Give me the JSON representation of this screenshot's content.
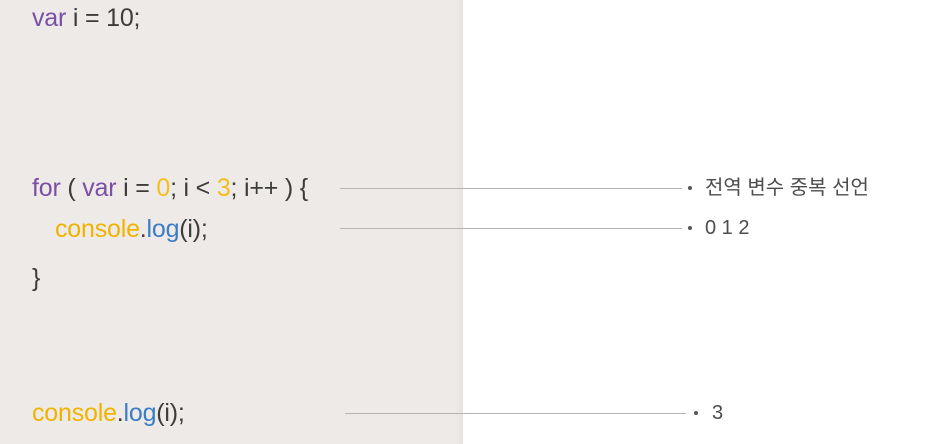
{
  "code": {
    "lines": [
      [
        "var",
        " i = 10;"
      ],
      [
        "for",
        " ( ",
        "var",
        " i = ",
        "0",
        "; i < ",
        "3",
        "; i++ ) {"
      ],
      [
        "console",
        ".",
        "log",
        "(i);"
      ],
      [
        "}"
      ],
      [
        "console",
        ".",
        "log",
        "(i);"
      ]
    ]
  },
  "annotations": [
    {
      "text": "전역 변수 중복 선언"
    },
    {
      "text": "0 1 2"
    },
    {
      "text": "3"
    }
  ],
  "colors": {
    "page_bg": "#ffffff",
    "panel": "#eeeae7",
    "keyword": "#7a4fa6",
    "plain": "#3c3c3c",
    "number": "#f4be1e",
    "object": "#f0b300",
    "method": "#3b7dc6",
    "connector": "#b4b4b4",
    "bullet": "#555555",
    "annotation": "#4d4d4d"
  }
}
